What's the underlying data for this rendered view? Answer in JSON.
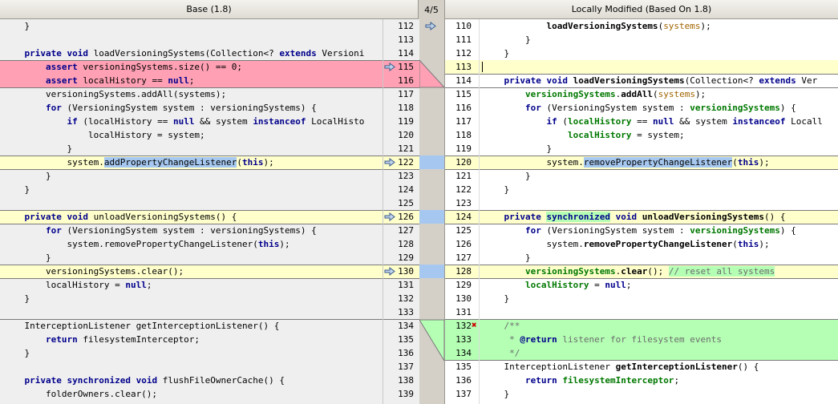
{
  "header": {
    "left_title": "Base (1.8)",
    "diff_counter": "4/5",
    "right_title": "Locally Modified (Based On 1.8)"
  },
  "left_line_numbers": [
    "112",
    "113",
    "114",
    "115",
    "116",
    "117",
    "118",
    "119",
    "120",
    "121",
    "122",
    "123",
    "124",
    "125",
    "126",
    "127",
    "128",
    "129",
    "130",
    "131",
    "132",
    "133",
    "134",
    "135",
    "136",
    "137",
    "138",
    "139"
  ],
  "right_line_numbers": [
    "110",
    "111",
    "112",
    "113",
    "114",
    "115",
    "116",
    "117",
    "118",
    "119",
    "120",
    "121",
    "122",
    "123",
    "124",
    "125",
    "126",
    "127",
    "128",
    "129",
    "130",
    "131",
    "132",
    "133",
    "134",
    "135",
    "136",
    "137"
  ],
  "left_code": [
    [
      {
        "t": "    }"
      }
    ],
    [
      {
        "t": ""
      }
    ],
    [
      {
        "t": "    "
      },
      {
        "t": "private void",
        "c": "kw"
      },
      {
        "t": " loadVersioningSystems(Collection<? "
      },
      {
        "t": "extends",
        "c": "kw"
      },
      {
        "t": " Versioni"
      }
    ],
    [
      {
        "t": "        "
      },
      {
        "t": "assert",
        "c": "kw"
      },
      {
        "t": " versioningSystems.size() == 0;"
      }
    ],
    [
      {
        "t": "        "
      },
      {
        "t": "assert",
        "c": "kw"
      },
      {
        "t": " localHistory == "
      },
      {
        "t": "null",
        "c": "kw"
      },
      {
        "t": ";"
      }
    ],
    [
      {
        "t": "        versioningSystems.addAll(systems);"
      }
    ],
    [
      {
        "t": "        "
      },
      {
        "t": "for",
        "c": "kw"
      },
      {
        "t": " (VersioningSystem system : versioningSystems) {"
      }
    ],
    [
      {
        "t": "            "
      },
      {
        "t": "if",
        "c": "kw"
      },
      {
        "t": " (localHistory == "
      },
      {
        "t": "null",
        "c": "kw"
      },
      {
        "t": " && system "
      },
      {
        "t": "instanceof",
        "c": "kw"
      },
      {
        "t": " LocalHisto"
      }
    ],
    [
      {
        "t": "                localHistory = system;"
      }
    ],
    [
      {
        "t": "            }"
      }
    ],
    [
      {
        "t": "            system."
      },
      {
        "t": "addPropertyChangeListener",
        "c": "hlb"
      },
      {
        "t": "("
      },
      {
        "t": "this",
        "c": "kw"
      },
      {
        "t": ");"
      }
    ],
    [
      {
        "t": "        }"
      }
    ],
    [
      {
        "t": "    }"
      }
    ],
    [
      {
        "t": ""
      }
    ],
    [
      {
        "t": "    "
      },
      {
        "t": "private void",
        "c": "kw"
      },
      {
        "t": " unloadVersioningSystems() {"
      }
    ],
    [
      {
        "t": "        "
      },
      {
        "t": "for",
        "c": "kw"
      },
      {
        "t": " (VersioningSystem system : versioningSystems) {"
      }
    ],
    [
      {
        "t": "            system.removePropertyChangeListener("
      },
      {
        "t": "this",
        "c": "kw"
      },
      {
        "t": ");"
      }
    ],
    [
      {
        "t": "        }"
      }
    ],
    [
      {
        "t": "        versioningSystems.clear();"
      }
    ],
    [
      {
        "t": "        localHistory = "
      },
      {
        "t": "null",
        "c": "kw"
      },
      {
        "t": ";"
      }
    ],
    [
      {
        "t": "    }"
      }
    ],
    [
      {
        "t": ""
      }
    ],
    [
      {
        "t": "    InterceptionListener getInterceptionListener() {"
      }
    ],
    [
      {
        "t": "        "
      },
      {
        "t": "return",
        "c": "kw"
      },
      {
        "t": " filesystemInterceptor;"
      }
    ],
    [
      {
        "t": "    }"
      }
    ],
    [
      {
        "t": ""
      }
    ],
    [
      {
        "t": "    "
      },
      {
        "t": "private synchronized void",
        "c": "kw"
      },
      {
        "t": " flushFileOwnerCache() {"
      }
    ],
    [
      {
        "t": "        folderOwners.clear();"
      }
    ]
  ],
  "right_code": [
    [
      {
        "t": "            "
      },
      {
        "t": "loadVersioningSystems",
        "c": "meth"
      },
      {
        "t": "("
      },
      {
        "t": "systems",
        "c": "prm"
      },
      {
        "t": ");"
      }
    ],
    [
      {
        "t": "        }"
      }
    ],
    [
      {
        "t": "    }"
      }
    ],
    [
      {
        "t": ""
      }
    ],
    [
      {
        "t": "    "
      },
      {
        "t": "private void",
        "c": "kw"
      },
      {
        "t": " "
      },
      {
        "t": "loadVersioningSystems",
        "c": "meth"
      },
      {
        "t": "(Collection<? "
      },
      {
        "t": "extends",
        "c": "kw"
      },
      {
        "t": " Ver"
      }
    ],
    [
      {
        "t": "        "
      },
      {
        "t": "versioningSystems",
        "c": "fld"
      },
      {
        "t": "."
      },
      {
        "t": "addAll",
        "c": "meth"
      },
      {
        "t": "("
      },
      {
        "t": "systems",
        "c": "prm"
      },
      {
        "t": ");"
      }
    ],
    [
      {
        "t": "        "
      },
      {
        "t": "for",
        "c": "kw"
      },
      {
        "t": " (VersioningSystem system : "
      },
      {
        "t": "versioningSystems",
        "c": "fld"
      },
      {
        "t": ") {"
      }
    ],
    [
      {
        "t": "            "
      },
      {
        "t": "if",
        "c": "kw"
      },
      {
        "t": " ("
      },
      {
        "t": "localHistory",
        "c": "fld"
      },
      {
        "t": " == "
      },
      {
        "t": "null",
        "c": "kw"
      },
      {
        "t": " && system "
      },
      {
        "t": "instanceof",
        "c": "kw"
      },
      {
        "t": " Locall"
      }
    ],
    [
      {
        "t": "                "
      },
      {
        "t": "localHistory",
        "c": "fld"
      },
      {
        "t": " = system;"
      }
    ],
    [
      {
        "t": "            }"
      }
    ],
    [
      {
        "t": "            system."
      },
      {
        "t": "removePropertyChangeListener",
        "c": "hlb"
      },
      {
        "t": "("
      },
      {
        "t": "this",
        "c": "kw"
      },
      {
        "t": ");"
      }
    ],
    [
      {
        "t": "        }"
      }
    ],
    [
      {
        "t": "    }"
      }
    ],
    [
      {
        "t": ""
      }
    ],
    [
      {
        "t": "    "
      },
      {
        "t": "private",
        "c": "kw"
      },
      {
        "t": " "
      },
      {
        "t": "synchronized",
        "c": "kw hlg"
      },
      {
        "t": " "
      },
      {
        "t": "void",
        "c": "kw"
      },
      {
        "t": " "
      },
      {
        "t": "unloadVersioningSystems",
        "c": "meth"
      },
      {
        "t": "() {"
      }
    ],
    [
      {
        "t": "        "
      },
      {
        "t": "for",
        "c": "kw"
      },
      {
        "t": " (VersioningSystem system : "
      },
      {
        "t": "versioningSystems",
        "c": "fld"
      },
      {
        "t": ") {"
      }
    ],
    [
      {
        "t": "            system."
      },
      {
        "t": "removePropertyChangeListener",
        "c": "meth"
      },
      {
        "t": "("
      },
      {
        "t": "this",
        "c": "kw"
      },
      {
        "t": ");"
      }
    ],
    [
      {
        "t": "        }"
      }
    ],
    [
      {
        "t": "        "
      },
      {
        "t": "versioningSystems",
        "c": "fld"
      },
      {
        "t": "."
      },
      {
        "t": "clear",
        "c": "meth"
      },
      {
        "t": "(); "
      },
      {
        "t": "// reset all systems",
        "c": "cmt hlg"
      }
    ],
    [
      {
        "t": "        "
      },
      {
        "t": "localHistory",
        "c": "fld"
      },
      {
        "t": " = "
      },
      {
        "t": "null",
        "c": "kw"
      },
      {
        "t": ";"
      }
    ],
    [
      {
        "t": "    }"
      }
    ],
    [
      {
        "t": ""
      }
    ],
    [
      {
        "t": "    "
      },
      {
        "t": "/**",
        "c": "doc"
      }
    ],
    [
      {
        "t": "     * ",
        "c": "doc"
      },
      {
        "t": "@return",
        "c": "doctag"
      },
      {
        "t": " listener for filesystem events",
        "c": "doc"
      }
    ],
    [
      {
        "t": "     */",
        "c": "doc"
      }
    ],
    [
      {
        "t": "    InterceptionListener "
      },
      {
        "t": "getInterceptionListener",
        "c": "meth"
      },
      {
        "t": "() {"
      }
    ],
    [
      {
        "t": "        "
      },
      {
        "t": "return",
        "c": "kw"
      },
      {
        "t": " "
      },
      {
        "t": "filesystemInterceptor",
        "c": "fld"
      },
      {
        "t": ";"
      }
    ],
    [
      {
        "t": "    }"
      }
    ]
  ],
  "icons": {
    "left_arrow": "diff-arrow-icon",
    "right_error": "error-x-icon"
  },
  "colors": {
    "changed": "#ffffcc",
    "removed": "#ffa0b4",
    "added": "#b4ffb4",
    "highlight": "#a6c8f0"
  }
}
